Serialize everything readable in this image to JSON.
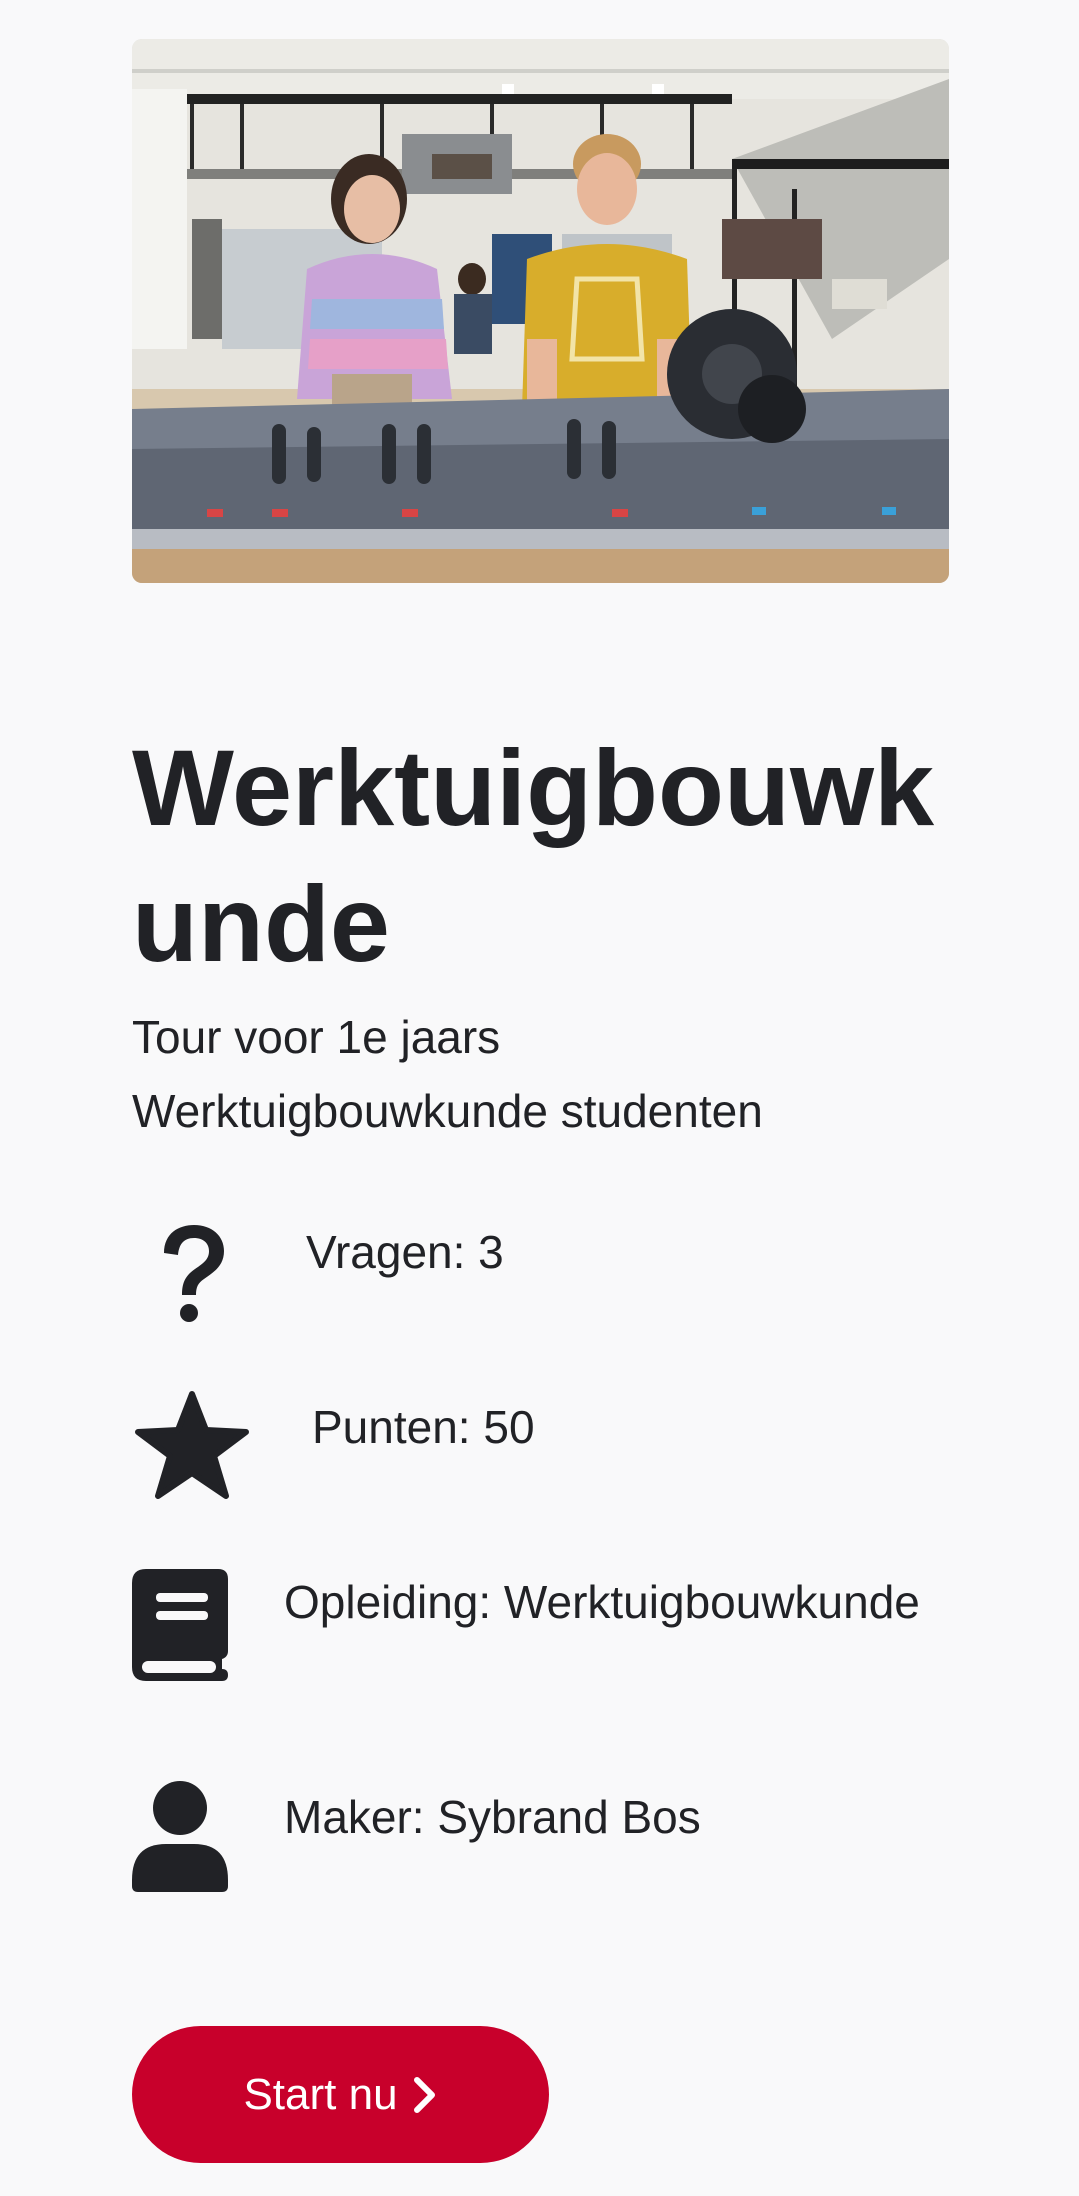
{
  "tour": {
    "title": "Werktuigbouwkunde",
    "description": "Tour voor 1e jaars Werktuigbouwkunde studenten"
  },
  "info": {
    "questions": "Vragen: 3",
    "points": "Punten: 50",
    "program": "Opleiding: Werktuigbouwkunde",
    "maker": "Maker: Sybrand Bos"
  },
  "icons": {
    "questions": "question-mark-icon",
    "points": "star-icon",
    "program": "book-icon",
    "maker": "user-icon"
  },
  "actions": {
    "start_label": "Start nu"
  },
  "colors": {
    "primary": "#c8002b",
    "text": "#212226",
    "background": "#f9f9fa"
  }
}
